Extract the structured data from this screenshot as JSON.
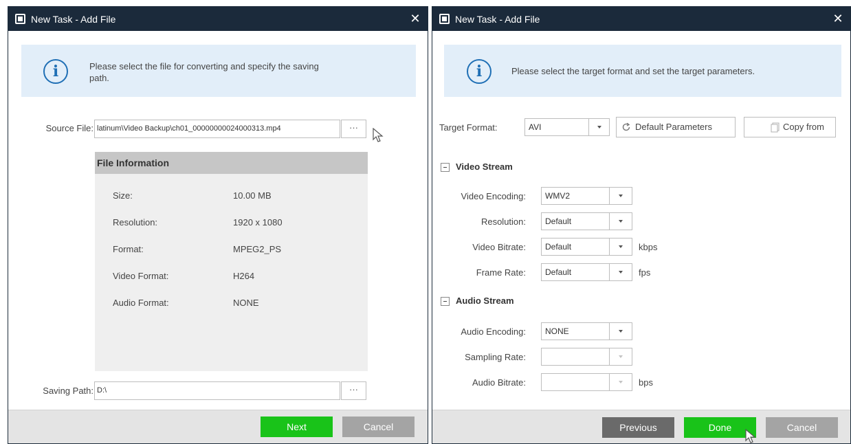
{
  "left_dialog": {
    "title": "New Task - Add File",
    "close_glyph": "✕",
    "info_icon_glyph": "i",
    "info_text": "Please select the file for converting and specify the saving path.",
    "source_file": {
      "label": "Source File:",
      "value": "latinum\\Video Backup\\ch01_00000000024000313.mp4",
      "browse_label": "···"
    },
    "file_information": {
      "header": "File Information",
      "rows": [
        {
          "key": "Size:",
          "value": "10.00 MB"
        },
        {
          "key": "Resolution:",
          "value": "1920 x 1080"
        },
        {
          "key": "Format:",
          "value": "MPEG2_PS"
        },
        {
          "key": "Video Format:",
          "value": "H264"
        },
        {
          "key": "Audio Format:",
          "value": "NONE"
        }
      ]
    },
    "saving_path": {
      "label": "Saving Path:",
      "value": "D:\\",
      "browse_label": "···"
    },
    "buttons": {
      "next": "Next",
      "cancel": "Cancel"
    }
  },
  "right_dialog": {
    "title": "New Task - Add File",
    "close_glyph": "✕",
    "info_icon_glyph": "i",
    "info_text": "Please select the target format and set the target parameters.",
    "target_format": {
      "label": "Target Format:",
      "value": "AVI"
    },
    "default_parameters_label": "Default Parameters",
    "copy_from_label": "Copy from",
    "video_stream": {
      "title": "Video Stream",
      "fields": [
        {
          "label": "Video Encoding:",
          "value": "WMV2",
          "unit": ""
        },
        {
          "label": "Resolution:",
          "value": "Default",
          "unit": ""
        },
        {
          "label": "Video Bitrate:",
          "value": "Default",
          "unit": "kbps"
        },
        {
          "label": "Frame Rate:",
          "value": "Default",
          "unit": "fps"
        }
      ]
    },
    "audio_stream": {
      "title": "Audio Stream",
      "fields": [
        {
          "label": "Audio Encoding:",
          "value": "NONE",
          "unit": ""
        },
        {
          "label": "Sampling Rate:",
          "value": "",
          "unit": ""
        },
        {
          "label": "Audio Bitrate:",
          "value": "",
          "unit": "bps"
        }
      ]
    },
    "buttons": {
      "previous": "Previous",
      "done": "Done",
      "cancel": "Cancel"
    }
  },
  "colors": {
    "titlebar": "#1b2a3b",
    "info_box": "#e2eef9",
    "info_icon": "#1f6fb5",
    "primary_button": "#19c319",
    "secondary_button": "#a4a4a4",
    "previous_button": "#6a6a6a",
    "file_info_header": "#c6c6c6",
    "file_info_body": "#efefef"
  },
  "icons": {
    "title": "document-icon",
    "close": "close-icon",
    "info": "info-icon",
    "browse": "ellipsis-icon",
    "dropdown": "chevron-down-icon",
    "default_parameters": "refresh-icon",
    "copy_from": "copy-icon",
    "section_toggle": "collapse-icon",
    "pointer": "mouse-cursor-icon"
  }
}
